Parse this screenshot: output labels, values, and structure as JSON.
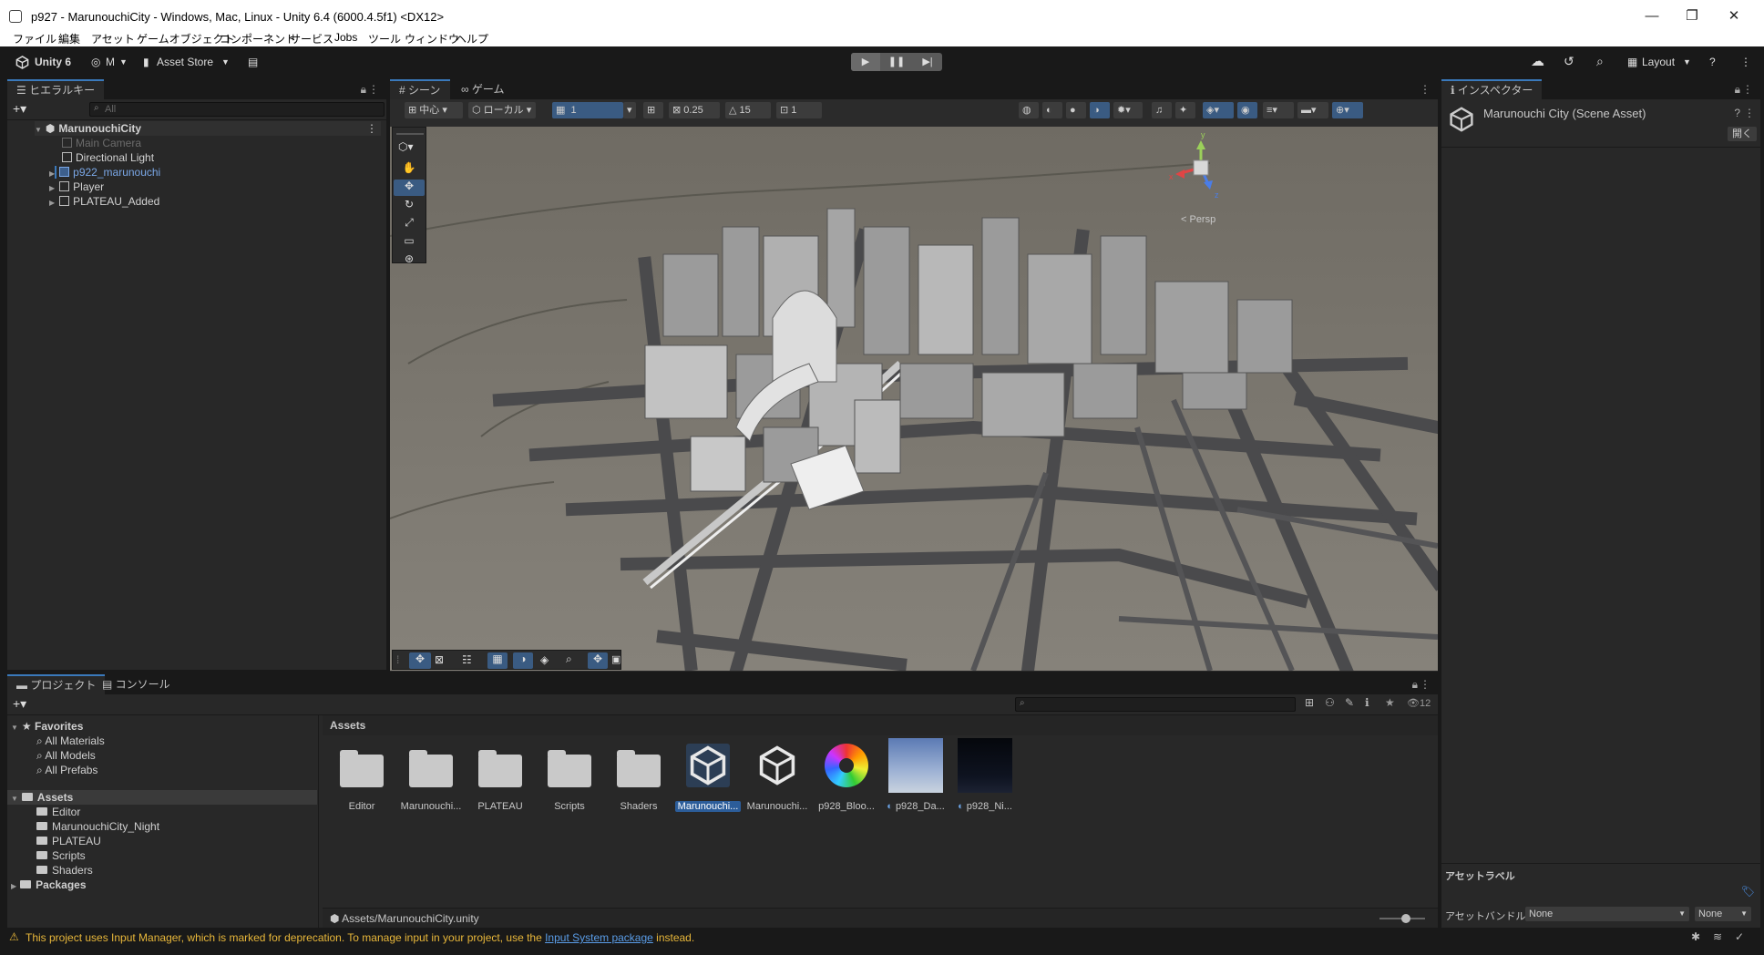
{
  "window": {
    "title": "p927 - MarunouchiCity - Windows, Mac, Linux - Unity 6.4 (6000.4.5f1) <DX12>",
    "minimize": "—",
    "maximize": "❐",
    "close": "✕"
  },
  "menu": [
    "ファイル",
    "編集",
    "アセット",
    "ゲームオブジェクト",
    "コンポーネント",
    "サービス",
    "Jobs",
    "ツール",
    "ウィンドウ",
    "ヘルプ"
  ],
  "toolbar": {
    "unity_label": "Unity 6",
    "account_label": "M",
    "asset_store_label": "Asset Store",
    "layout_label": "Layout",
    "play_icon": "▶",
    "pause_icon": "❚❚",
    "step_icon": "▶|"
  },
  "hierarchy": {
    "tab_label": "ヒエラルキー",
    "search_placeholder": "All",
    "scene_name": "MarunouchiCity",
    "items": [
      {
        "label": "Main Camera"
      },
      {
        "label": "Directional Light"
      },
      {
        "label": "p922_marunouchi"
      },
      {
        "label": "Player"
      },
      {
        "label": "PLATEAU_Added"
      }
    ]
  },
  "scene": {
    "tabs": [
      "シーン",
      "ゲーム"
    ],
    "pivot_label": "中心",
    "space_label": "ローカル",
    "grid_value": "1",
    "snap_value": "0.25",
    "rotate_snap": "15",
    "scale_snap": "1",
    "persp_label": "< Persp",
    "gizmo_labels": {
      "y": "y",
      "x": "x",
      "z": "z"
    }
  },
  "inspector": {
    "tab_label": "インスペクター",
    "asset_title": "Marunouchi City (Scene Asset)",
    "open_button": "開く",
    "asset_labels_title": "アセットラベル",
    "asset_bundle_label": "アセットバンドル",
    "bundle_value": "None",
    "variant_value": "None"
  },
  "project": {
    "tabs": [
      "プロジェクト",
      "コンソール"
    ],
    "favorites_label": "Favorites",
    "favorites": [
      "All Materials",
      "All Models",
      "All Prefabs"
    ],
    "assets_label": "Assets",
    "asset_folders": [
      "Editor",
      "MarunouchiCity_Night",
      "PLATEAU",
      "Scripts",
      "Shaders"
    ],
    "packages_label": "Packages",
    "breadcrumb": "Assets",
    "hidden_count": "12",
    "path": "Assets/MarunouchiCity.unity",
    "items": [
      {
        "label": "Editor",
        "kind": "folder"
      },
      {
        "label": "Marunouchi...",
        "kind": "folder"
      },
      {
        "label": "PLATEAU",
        "kind": "folder"
      },
      {
        "label": "Scripts",
        "kind": "folder"
      },
      {
        "label": "Shaders",
        "kind": "folder"
      },
      {
        "label": "Marunouchi...",
        "kind": "scene-selected"
      },
      {
        "label": "Marunouchi...",
        "kind": "scene"
      },
      {
        "label": "p928_Bloo...",
        "kind": "volume-profile"
      },
      {
        "label": "p928_Da...",
        "kind": "sky-day"
      },
      {
        "label": "p928_Ni...",
        "kind": "sky-night"
      }
    ]
  },
  "status": {
    "message_before": "This project uses Input Manager, which is marked for deprecation. To manage input in your project, use the ",
    "link": "Input System package",
    "message_after": " instead.",
    "warning_color": "#e8b73a"
  }
}
